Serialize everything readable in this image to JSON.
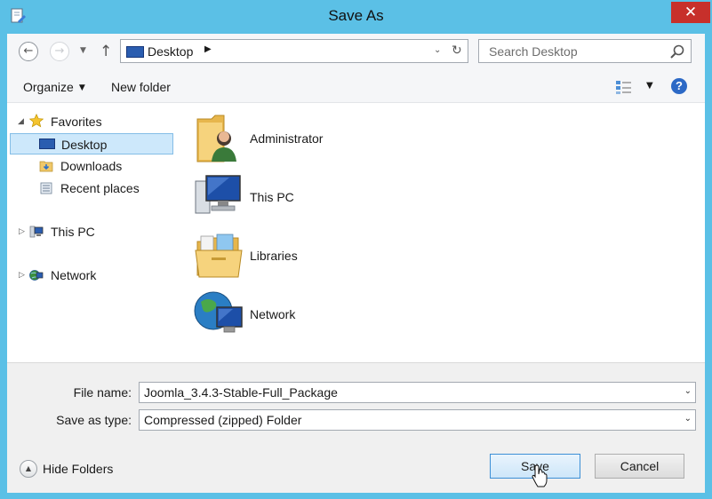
{
  "window": {
    "title": "Save As",
    "close_glyph": "✕",
    "accent_color": "#5bc0e6"
  },
  "navigation": {
    "back_glyph": "←",
    "forward_glyph": "→",
    "recent_glyph": "▼",
    "up_glyph": "↑",
    "address_location": "Desktop",
    "address_separator": "▶",
    "address_dropdown_glyph": "⌄",
    "refresh_glyph": "↻",
    "search_placeholder": "Search Desktop"
  },
  "command_bar": {
    "organize_label": "Organize",
    "organize_caret": "▼",
    "new_folder_label": "New folder",
    "view_drop_glyph": "▼",
    "help_glyph": "?"
  },
  "nav_tree": {
    "favorites": {
      "label": "Favorites",
      "expander": "◢",
      "icon": "star-icon"
    },
    "favorite_items": [
      {
        "label": "Desktop",
        "icon": "desktop-icon",
        "selected": true
      },
      {
        "label": "Downloads",
        "icon": "downloads-icon",
        "selected": false
      },
      {
        "label": "Recent places",
        "icon": "recent-places-icon",
        "selected": false
      }
    ],
    "this_pc": {
      "label": "This PC",
      "expander": "▷",
      "icon": "computer-icon"
    },
    "network": {
      "label": "Network",
      "expander": "▷",
      "icon": "network-icon"
    }
  },
  "content_items": [
    {
      "name": "Administrator",
      "icon": "user-folder-icon"
    },
    {
      "name": "This PC",
      "icon": "computer-icon"
    },
    {
      "name": "Libraries",
      "icon": "libraries-icon"
    },
    {
      "name": "Network",
      "icon": "network-globe-icon"
    }
  ],
  "form": {
    "file_name_label": "File name:",
    "file_name_value": "Joomla_3.4.3-Stable-Full_Package",
    "save_type_label": "Save as type:",
    "save_type_value": "Compressed (zipped) Folder",
    "combo_arrow": "⌄",
    "hide_folders_glyph": "▲",
    "hide_folders_label": "Hide Folders",
    "save_label": "Save",
    "cancel_label": "Cancel"
  }
}
